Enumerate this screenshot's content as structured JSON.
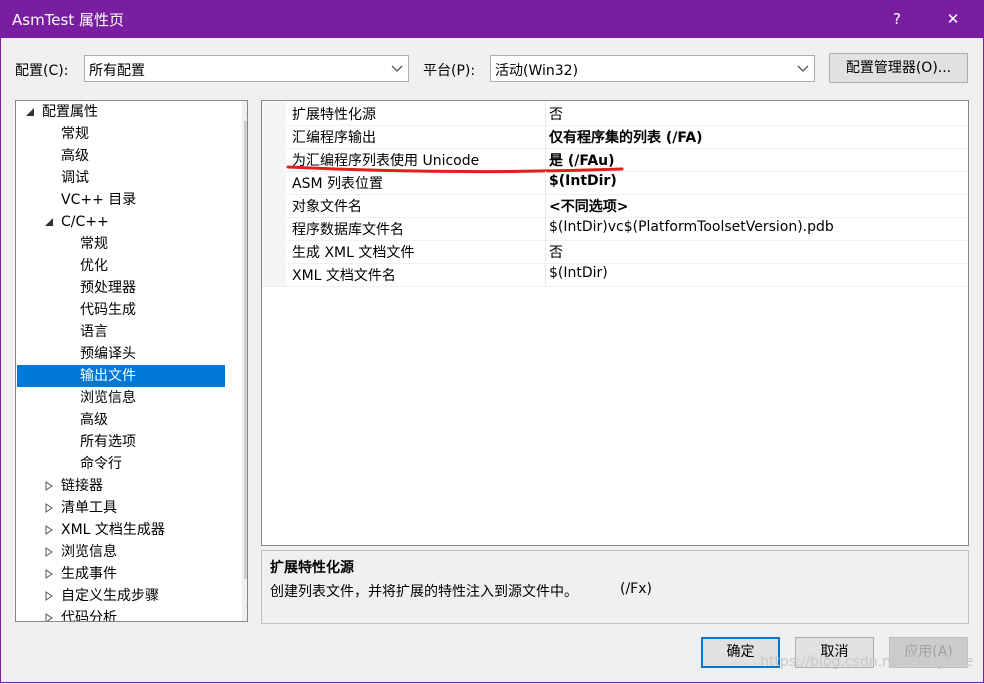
{
  "window": {
    "title": "AsmTest 属性页",
    "help_label": "?",
    "close_label": "✕",
    "accent": "#7a1ea1"
  },
  "config_row": {
    "config_label": "配置(C):",
    "config_value": "所有配置",
    "platform_label": "平台(P):",
    "platform_value": "活动(Win32)",
    "manager_button": "配置管理器(O)..."
  },
  "tree": {
    "items": [
      {
        "label": "配置属性",
        "expander": "expanded"
      },
      {
        "label": "常规"
      },
      {
        "label": "高级"
      },
      {
        "label": "调试"
      },
      {
        "label": "VC++ 目录"
      },
      {
        "label": "C/C++",
        "expander": "expanded"
      },
      {
        "label": "常规"
      },
      {
        "label": "优化"
      },
      {
        "label": "预处理器"
      },
      {
        "label": "代码生成"
      },
      {
        "label": "语言"
      },
      {
        "label": "预编译头"
      },
      {
        "label": "输出文件",
        "selected": true
      },
      {
        "label": "浏览信息"
      },
      {
        "label": "高级"
      },
      {
        "label": "所有选项"
      },
      {
        "label": "命令行"
      },
      {
        "label": "链接器",
        "expander": "collapsed"
      },
      {
        "label": "清单工具",
        "expander": "collapsed"
      },
      {
        "label": "XML 文档生成器",
        "expander": "collapsed"
      },
      {
        "label": "浏览信息",
        "expander": "collapsed"
      },
      {
        "label": "生成事件",
        "expander": "collapsed"
      },
      {
        "label": "自定义生成步骤",
        "expander": "collapsed"
      },
      {
        "label": "代码分析",
        "expander": "collapsed"
      }
    ]
  },
  "grid": {
    "rows": [
      {
        "name": "扩展特性化源",
        "value": "否",
        "bold": false
      },
      {
        "name": "汇编程序输出",
        "value": "仅有程序集的列表 (/FA)",
        "bold": true
      },
      {
        "name": "为汇编程序列表使用 Unicode",
        "value": "是 (/FAu)",
        "bold": true,
        "underlined": true
      },
      {
        "name": "ASM 列表位置",
        "value": "$(IntDir)",
        "bold": true
      },
      {
        "name": "对象文件名",
        "value": "<不同选项>",
        "bold": true
      },
      {
        "name": "程序数据库文件名",
        "value": "$(IntDir)vc$(PlatformToolsetVersion).pdb",
        "bold": false
      },
      {
        "name": "生成 XML 文档文件",
        "value": "否",
        "bold": false
      },
      {
        "name": "XML 文档文件名",
        "value": "$(IntDir)",
        "bold": false
      }
    ]
  },
  "description": {
    "title": "扩展特性化源",
    "text": "创建列表文件，并将扩展的特性注入到源文件中。",
    "switch": "(/Fx)"
  },
  "footer": {
    "ok": "确定",
    "cancel": "取消",
    "apply": "应用(A)"
  },
  "watermark": "https://blog.csdn.net/FishyFine",
  "colors": {
    "selection": "#0078d7",
    "annotation_underline": "#e0201b"
  }
}
